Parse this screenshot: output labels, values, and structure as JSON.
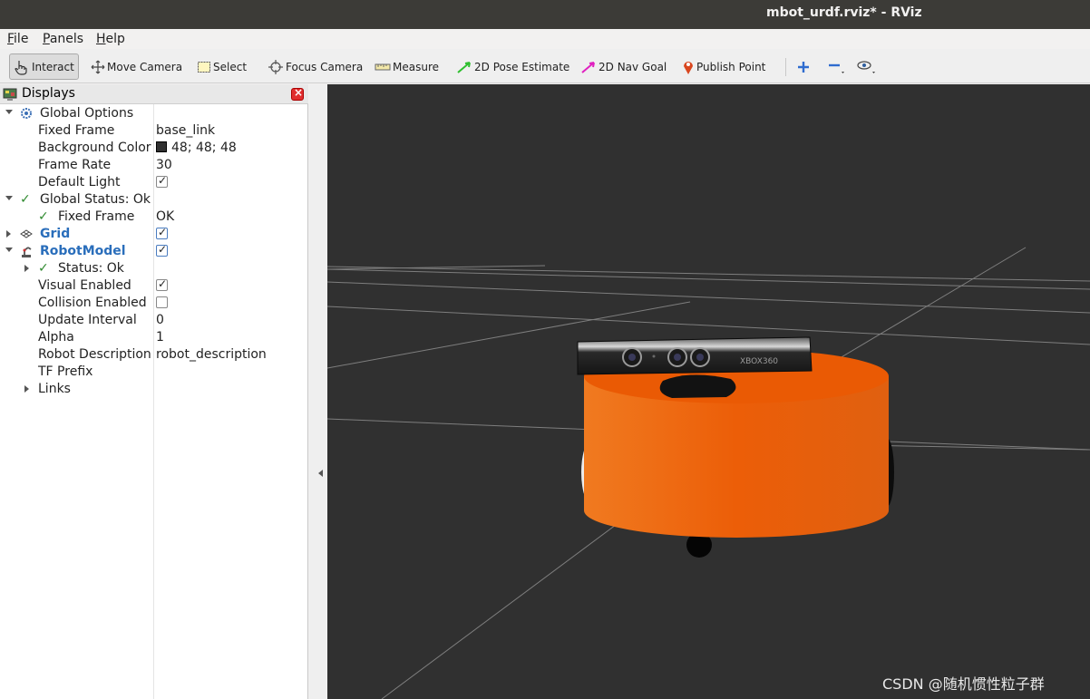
{
  "window": {
    "title": "mbot_urdf.rviz* - RViz"
  },
  "menu": {
    "file": "File",
    "panels": "Panels",
    "help": "Help"
  },
  "toolbar": {
    "interact": "Interact",
    "move_camera": "Move Camera",
    "select": "Select",
    "focus_camera": "Focus Camera",
    "measure": "Measure",
    "pose_estimate": "2D Pose Estimate",
    "nav_goal": "2D Nav Goal",
    "publish_point": "Publish Point"
  },
  "displays": {
    "title": "Displays",
    "global_options": "Global Options",
    "fixed_frame_label": "Fixed Frame",
    "fixed_frame_value": "base_link",
    "bg_color_label": "Background Color",
    "bg_color_value": "48; 48; 48",
    "frame_rate_label": "Frame Rate",
    "frame_rate_value": "30",
    "default_light_label": "Default Light",
    "global_status": "Global Status: Ok",
    "status_fixed_frame": "Fixed Frame",
    "status_fixed_frame_value": "OK",
    "grid": "Grid",
    "robot_model": "RobotModel",
    "status_ok": "Status: Ok",
    "visual_enabled": "Visual Enabled",
    "collision_enabled": "Collision Enabled",
    "update_interval_label": "Update Interval",
    "update_interval_value": "0",
    "alpha_label": "Alpha",
    "alpha_value": "1",
    "robot_description_label": "Robot Description",
    "robot_description_value": "robot_description",
    "tf_prefix": "TF Prefix",
    "links": "Links"
  },
  "viewport": {
    "background_color": "#303030",
    "kinect_label": "XBOX360"
  },
  "watermark": "CSDN @随机惯性粒子群"
}
